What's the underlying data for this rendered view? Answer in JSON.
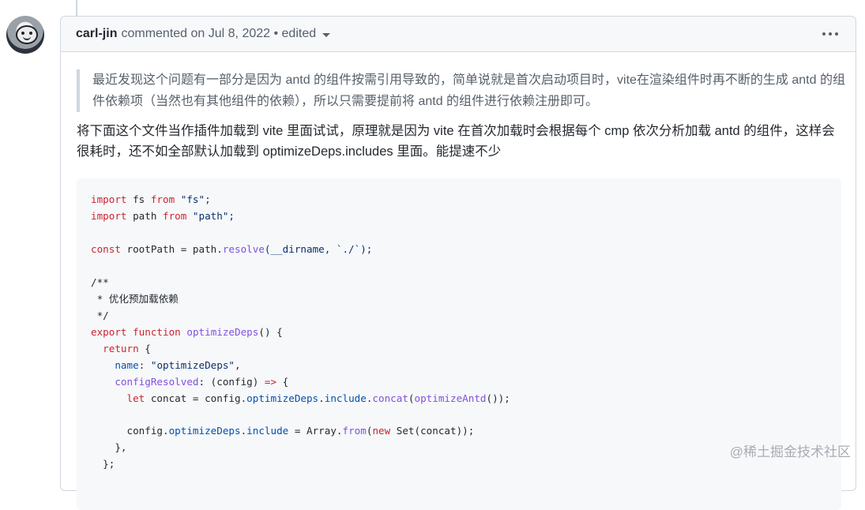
{
  "comment": {
    "author": "carl-jin",
    "meta": "commented on Jul 8, 2022 • edited",
    "quote": "最近发现这个问题有一部分是因为 antd 的组件按需引用导致的，简单说就是首次启动项目时，vite在渲染组件时再不断的生成 antd 的组件依赖项（当然也有其他组件的依赖），所以只需要提前将 antd 的组件进行依赖注册即可。",
    "paragraph": "将下面这个文件当作插件加载到 vite 里面试试，原理就是因为 vite 在首次加载时会根据每个 cmp 依次分析加载 antd 的组件，这样会很耗时，还不如全部默认加载到 optimizeDeps.includes 里面。能提速不少"
  },
  "code": {
    "l1": [
      "import",
      " fs ",
      "from",
      " \"fs\";"
    ],
    "l2": [
      "import",
      " path ",
      "from",
      " \"path\";"
    ],
    "l4": [
      "const",
      " rootPath = path.",
      "resolve",
      "(__dirname, `./`);"
    ],
    "l6": "/**",
    "l7": " * 优化预加载依赖",
    "l8": " */",
    "l9": [
      "export",
      " ",
      "function",
      " ",
      "optimizeDeps",
      "() {"
    ],
    "l10": [
      "  ",
      "return",
      " {"
    ],
    "l11": [
      "    ",
      "name",
      ": ",
      "\"optimizeDeps\"",
      ","
    ],
    "l12": [
      "    ",
      "configResolved",
      ": (config) ",
      "=>",
      " {"
    ],
    "l13": [
      "      ",
      "let",
      " concat = config.",
      "optimizeDeps",
      ".",
      "include",
      ".",
      "concat",
      "(",
      "optimizeAntd",
      "());"
    ],
    "l15": [
      "      config.",
      "optimizeDeps",
      ".",
      "include",
      " = Array.",
      "from",
      "(",
      "new",
      " Set(concat));"
    ],
    "l16": "    },",
    "l17": "  };"
  },
  "watermark": "@稀土掘金技术社区",
  "icons": {
    "menu": "kebab-horizontal-icon",
    "caret": "triangle-down-icon"
  }
}
